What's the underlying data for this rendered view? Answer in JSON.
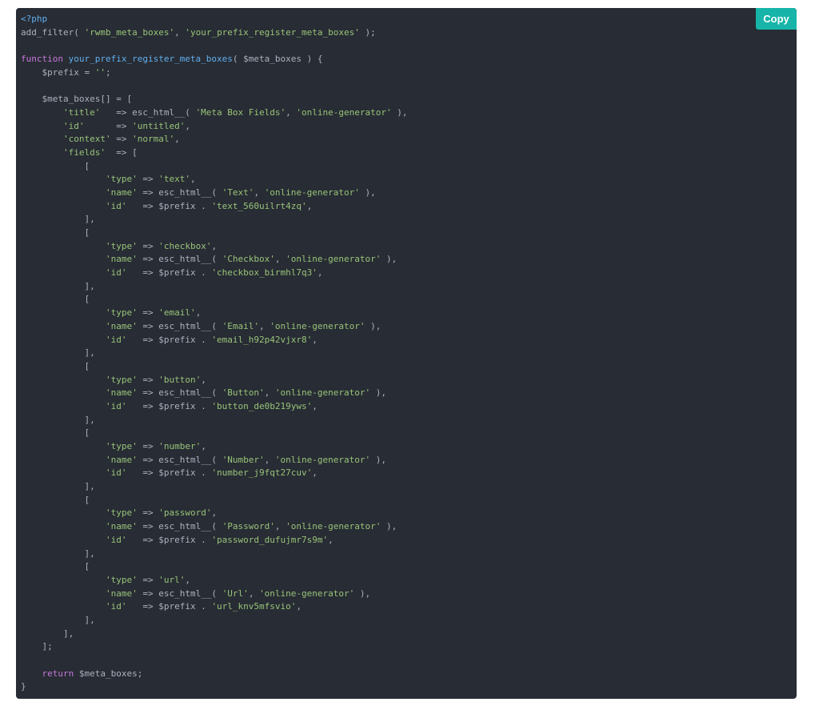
{
  "copy_button": {
    "label": "Copy"
  },
  "colors": {
    "background": "#282c34",
    "default": "#abb2bf",
    "string": "#98c379",
    "keyword": "#c678dd",
    "function": "#61afef",
    "meta": "#61afef",
    "copy_button_bg": "#17b5a9"
  },
  "code_lines": [
    [
      {
        "t": "<?php",
        "k": "meta"
      }
    ],
    [
      {
        "t": "add_filter( ",
        "k": "default"
      },
      {
        "t": "'rwmb_meta_boxes'",
        "k": "string"
      },
      {
        "t": ", ",
        "k": "default"
      },
      {
        "t": "'your_prefix_register_meta_boxes'",
        "k": "string"
      },
      {
        "t": " );",
        "k": "default"
      }
    ],
    [],
    [
      {
        "t": "function",
        "k": "keyword"
      },
      {
        "t": " ",
        "k": "default"
      },
      {
        "t": "your_prefix_register_meta_boxes",
        "k": "function"
      },
      {
        "t": "( $meta_boxes ) {",
        "k": "default"
      }
    ],
    [
      {
        "t": "    $prefix = ",
        "k": "default"
      },
      {
        "t": "''",
        "k": "string"
      },
      {
        "t": ";",
        "k": "default"
      }
    ],
    [],
    [
      {
        "t": "    $meta_boxes[] = [",
        "k": "default"
      }
    ],
    [
      {
        "t": "        ",
        "k": "default"
      },
      {
        "t": "'title'",
        "k": "string"
      },
      {
        "t": "   => esc_html__( ",
        "k": "default"
      },
      {
        "t": "'Meta Box Fields'",
        "k": "string"
      },
      {
        "t": ", ",
        "k": "default"
      },
      {
        "t": "'online-generator'",
        "k": "string"
      },
      {
        "t": " ),",
        "k": "default"
      }
    ],
    [
      {
        "t": "        ",
        "k": "default"
      },
      {
        "t": "'id'",
        "k": "string"
      },
      {
        "t": "      => ",
        "k": "default"
      },
      {
        "t": "'untitled'",
        "k": "string"
      },
      {
        "t": ",",
        "k": "default"
      }
    ],
    [
      {
        "t": "        ",
        "k": "default"
      },
      {
        "t": "'context'",
        "k": "string"
      },
      {
        "t": " => ",
        "k": "default"
      },
      {
        "t": "'normal'",
        "k": "string"
      },
      {
        "t": ",",
        "k": "default"
      }
    ],
    [
      {
        "t": "        ",
        "k": "default"
      },
      {
        "t": "'fields'",
        "k": "string"
      },
      {
        "t": "  => [",
        "k": "default"
      }
    ],
    [
      {
        "t": "            [",
        "k": "default"
      }
    ],
    [
      {
        "t": "                ",
        "k": "default"
      },
      {
        "t": "'type'",
        "k": "string"
      },
      {
        "t": " => ",
        "k": "default"
      },
      {
        "t": "'text'",
        "k": "string"
      },
      {
        "t": ",",
        "k": "default"
      }
    ],
    [
      {
        "t": "                ",
        "k": "default"
      },
      {
        "t": "'name'",
        "k": "string"
      },
      {
        "t": " => esc_html__( ",
        "k": "default"
      },
      {
        "t": "'Text'",
        "k": "string"
      },
      {
        "t": ", ",
        "k": "default"
      },
      {
        "t": "'online-generator'",
        "k": "string"
      },
      {
        "t": " ),",
        "k": "default"
      }
    ],
    [
      {
        "t": "                ",
        "k": "default"
      },
      {
        "t": "'id'",
        "k": "string"
      },
      {
        "t": "   => $prefix . ",
        "k": "default"
      },
      {
        "t": "'text_560uilrt4zq'",
        "k": "string"
      },
      {
        "t": ",",
        "k": "default"
      }
    ],
    [
      {
        "t": "            ],",
        "k": "default"
      }
    ],
    [
      {
        "t": "            [",
        "k": "default"
      }
    ],
    [
      {
        "t": "                ",
        "k": "default"
      },
      {
        "t": "'type'",
        "k": "string"
      },
      {
        "t": " => ",
        "k": "default"
      },
      {
        "t": "'checkbox'",
        "k": "string"
      },
      {
        "t": ",",
        "k": "default"
      }
    ],
    [
      {
        "t": "                ",
        "k": "default"
      },
      {
        "t": "'name'",
        "k": "string"
      },
      {
        "t": " => esc_html__( ",
        "k": "default"
      },
      {
        "t": "'Checkbox'",
        "k": "string"
      },
      {
        "t": ", ",
        "k": "default"
      },
      {
        "t": "'online-generator'",
        "k": "string"
      },
      {
        "t": " ),",
        "k": "default"
      }
    ],
    [
      {
        "t": "                ",
        "k": "default"
      },
      {
        "t": "'id'",
        "k": "string"
      },
      {
        "t": "   => $prefix . ",
        "k": "default"
      },
      {
        "t": "'checkbox_birmhl7q3'",
        "k": "string"
      },
      {
        "t": ",",
        "k": "default"
      }
    ],
    [
      {
        "t": "            ],",
        "k": "default"
      }
    ],
    [
      {
        "t": "            [",
        "k": "default"
      }
    ],
    [
      {
        "t": "                ",
        "k": "default"
      },
      {
        "t": "'type'",
        "k": "string"
      },
      {
        "t": " => ",
        "k": "default"
      },
      {
        "t": "'email'",
        "k": "string"
      },
      {
        "t": ",",
        "k": "default"
      }
    ],
    [
      {
        "t": "                ",
        "k": "default"
      },
      {
        "t": "'name'",
        "k": "string"
      },
      {
        "t": " => esc_html__( ",
        "k": "default"
      },
      {
        "t": "'Email'",
        "k": "string"
      },
      {
        "t": ", ",
        "k": "default"
      },
      {
        "t": "'online-generator'",
        "k": "string"
      },
      {
        "t": " ),",
        "k": "default"
      }
    ],
    [
      {
        "t": "                ",
        "k": "default"
      },
      {
        "t": "'id'",
        "k": "string"
      },
      {
        "t": "   => $prefix . ",
        "k": "default"
      },
      {
        "t": "'email_h92p42vjxr8'",
        "k": "string"
      },
      {
        "t": ",",
        "k": "default"
      }
    ],
    [
      {
        "t": "            ],",
        "k": "default"
      }
    ],
    [
      {
        "t": "            [",
        "k": "default"
      }
    ],
    [
      {
        "t": "                ",
        "k": "default"
      },
      {
        "t": "'type'",
        "k": "string"
      },
      {
        "t": " => ",
        "k": "default"
      },
      {
        "t": "'button'",
        "k": "string"
      },
      {
        "t": ",",
        "k": "default"
      }
    ],
    [
      {
        "t": "                ",
        "k": "default"
      },
      {
        "t": "'name'",
        "k": "string"
      },
      {
        "t": " => esc_html__( ",
        "k": "default"
      },
      {
        "t": "'Button'",
        "k": "string"
      },
      {
        "t": ", ",
        "k": "default"
      },
      {
        "t": "'online-generator'",
        "k": "string"
      },
      {
        "t": " ),",
        "k": "default"
      }
    ],
    [
      {
        "t": "                ",
        "k": "default"
      },
      {
        "t": "'id'",
        "k": "string"
      },
      {
        "t": "   => $prefix . ",
        "k": "default"
      },
      {
        "t": "'button_de0b219yws'",
        "k": "string"
      },
      {
        "t": ",",
        "k": "default"
      }
    ],
    [
      {
        "t": "            ],",
        "k": "default"
      }
    ],
    [
      {
        "t": "            [",
        "k": "default"
      }
    ],
    [
      {
        "t": "                ",
        "k": "default"
      },
      {
        "t": "'type'",
        "k": "string"
      },
      {
        "t": " => ",
        "k": "default"
      },
      {
        "t": "'number'",
        "k": "string"
      },
      {
        "t": ",",
        "k": "default"
      }
    ],
    [
      {
        "t": "                ",
        "k": "default"
      },
      {
        "t": "'name'",
        "k": "string"
      },
      {
        "t": " => esc_html__( ",
        "k": "default"
      },
      {
        "t": "'Number'",
        "k": "string"
      },
      {
        "t": ", ",
        "k": "default"
      },
      {
        "t": "'online-generator'",
        "k": "string"
      },
      {
        "t": " ),",
        "k": "default"
      }
    ],
    [
      {
        "t": "                ",
        "k": "default"
      },
      {
        "t": "'id'",
        "k": "string"
      },
      {
        "t": "   => $prefix . ",
        "k": "default"
      },
      {
        "t": "'number_j9fqt27cuv'",
        "k": "string"
      },
      {
        "t": ",",
        "k": "default"
      }
    ],
    [
      {
        "t": "            ],",
        "k": "default"
      }
    ],
    [
      {
        "t": "            [",
        "k": "default"
      }
    ],
    [
      {
        "t": "                ",
        "k": "default"
      },
      {
        "t": "'type'",
        "k": "string"
      },
      {
        "t": " => ",
        "k": "default"
      },
      {
        "t": "'password'",
        "k": "string"
      },
      {
        "t": ",",
        "k": "default"
      }
    ],
    [
      {
        "t": "                ",
        "k": "default"
      },
      {
        "t": "'name'",
        "k": "string"
      },
      {
        "t": " => esc_html__( ",
        "k": "default"
      },
      {
        "t": "'Password'",
        "k": "string"
      },
      {
        "t": ", ",
        "k": "default"
      },
      {
        "t": "'online-generator'",
        "k": "string"
      },
      {
        "t": " ),",
        "k": "default"
      }
    ],
    [
      {
        "t": "                ",
        "k": "default"
      },
      {
        "t": "'id'",
        "k": "string"
      },
      {
        "t": "   => $prefix . ",
        "k": "default"
      },
      {
        "t": "'password_dufujmr7s9m'",
        "k": "string"
      },
      {
        "t": ",",
        "k": "default"
      }
    ],
    [
      {
        "t": "            ],",
        "k": "default"
      }
    ],
    [
      {
        "t": "            [",
        "k": "default"
      }
    ],
    [
      {
        "t": "                ",
        "k": "default"
      },
      {
        "t": "'type'",
        "k": "string"
      },
      {
        "t": " => ",
        "k": "default"
      },
      {
        "t": "'url'",
        "k": "string"
      },
      {
        "t": ",",
        "k": "default"
      }
    ],
    [
      {
        "t": "                ",
        "k": "default"
      },
      {
        "t": "'name'",
        "k": "string"
      },
      {
        "t": " => esc_html__( ",
        "k": "default"
      },
      {
        "t": "'Url'",
        "k": "string"
      },
      {
        "t": ", ",
        "k": "default"
      },
      {
        "t": "'online-generator'",
        "k": "string"
      },
      {
        "t": " ),",
        "k": "default"
      }
    ],
    [
      {
        "t": "                ",
        "k": "default"
      },
      {
        "t": "'id'",
        "k": "string"
      },
      {
        "t": "   => $prefix . ",
        "k": "default"
      },
      {
        "t": "'url_knv5mfsvio'",
        "k": "string"
      },
      {
        "t": ",",
        "k": "default"
      }
    ],
    [
      {
        "t": "            ],",
        "k": "default"
      }
    ],
    [
      {
        "t": "        ],",
        "k": "default"
      }
    ],
    [
      {
        "t": "    ];",
        "k": "default"
      }
    ],
    [],
    [
      {
        "t": "    ",
        "k": "default"
      },
      {
        "t": "return",
        "k": "keyword"
      },
      {
        "t": " $meta_boxes;",
        "k": "default"
      }
    ],
    [
      {
        "t": "}",
        "k": "default"
      }
    ]
  ]
}
